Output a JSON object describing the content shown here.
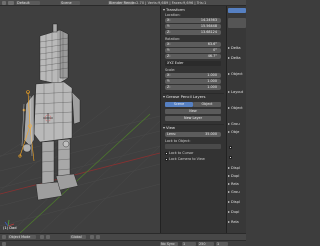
{
  "header": {
    "editor_icon": "3d-view-icon",
    "screen_name": "Default",
    "scene_name": "Scene",
    "render_engine": "Blender Render",
    "stats": "v2.70 | Verts:9,689 | Faces:9,696 | Tris:1"
  },
  "viewport": {
    "object_label": "(1) Dad"
  },
  "properties": {
    "transform_title": "Transform",
    "location_label": "Location:",
    "location": [
      {
        "axis": "X:",
        "value": "14.24563"
      },
      {
        "axis": "Y:",
        "value": "15.56448"
      },
      {
        "axis": "Z:",
        "value": "13.68124"
      }
    ],
    "rotation_label": "Rotation:",
    "rotation": [
      {
        "axis": "X:",
        "value": "63.6°"
      },
      {
        "axis": "Y:",
        "value": "0°"
      },
      {
        "axis": "Z:",
        "value": "46.7°"
      }
    ],
    "rotation_mode": "XYZ Euler",
    "scale_label": "Scale:",
    "scale": [
      {
        "axis": "X:",
        "value": "1.000"
      },
      {
        "axis": "Y:",
        "value": "1.000"
      },
      {
        "axis": "Z:",
        "value": "1.000"
      }
    ],
    "grease_pencil_title": "Grease Pencil Layers",
    "scene_btn": "Scene",
    "object_btn": "Object",
    "new_btn": "New",
    "new_layer_btn": "New Layer",
    "view_title": "View",
    "lens_label": "Lens:",
    "lens_value": "35.000",
    "lock_to_object": "Lock to Object:",
    "lock_to_cursor": "Lock to Cursor",
    "lock_camera_to_view": "Lock Camera to View"
  },
  "outliner": {
    "items": [
      "Delta",
      "Delta",
      "Object",
      "Layout",
      "Object",
      "Grou",
      "Obje",
      "Displ",
      "Dupl",
      "Rela",
      "Grou",
      "Displ",
      "Dupl",
      "Rela"
    ]
  },
  "footer": {
    "mode": "Object Mode",
    "pivot": "Global",
    "sync": "No Sync",
    "frame_start": "1",
    "frame_end": "250",
    "current_frame": "1"
  },
  "colors": {
    "accent": "#5680c2",
    "viewport_bg": "#3f3f3f",
    "panel_bg": "#333333",
    "selected_outline": "#f5a623"
  }
}
